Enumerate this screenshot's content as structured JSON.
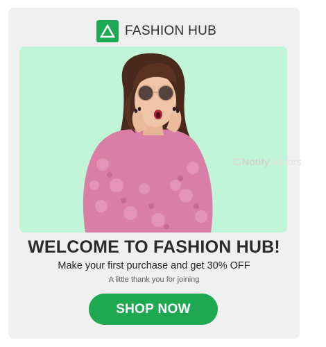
{
  "brand": {
    "name": "FASHION HUB",
    "logo_icon": "triangle-logo-icon",
    "logo_color": "#1eaa55"
  },
  "hero": {
    "image": "woman-pink-fur-coat-sunglasses-surprised",
    "background_color": "#c0f5d8"
  },
  "content": {
    "headline": "WELCOME TO FASHION HUB!",
    "subline": "Make your first purchase and get 30% OFF",
    "note": "A little thank you for joining"
  },
  "cta": {
    "label": "SHOP NOW",
    "color": "#1da851"
  },
  "watermark": {
    "part1": "Notify",
    "part2": "Visitors"
  }
}
